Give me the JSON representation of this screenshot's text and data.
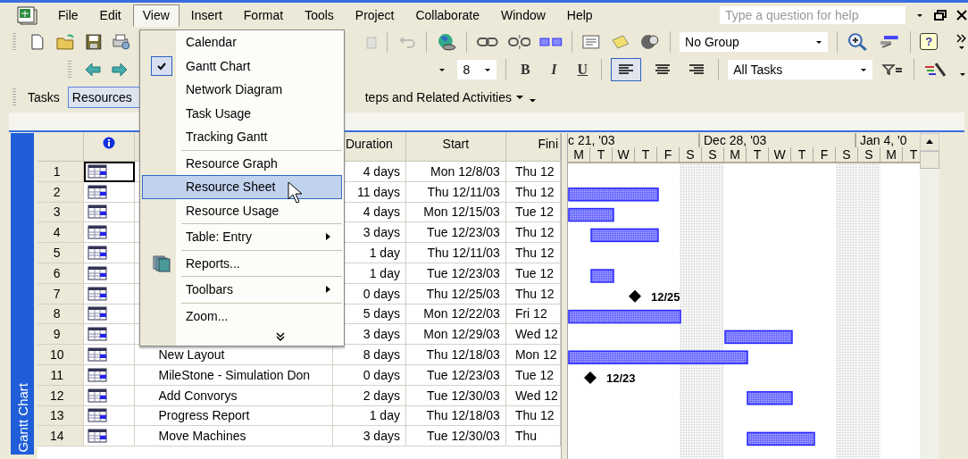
{
  "menubar": [
    {
      "label": "File",
      "selected": false
    },
    {
      "label": "Edit",
      "selected": false
    },
    {
      "label": "View",
      "selected": true
    },
    {
      "label": "Insert",
      "selected": false
    },
    {
      "label": "Format",
      "selected": false
    },
    {
      "label": "Tools",
      "selected": false
    },
    {
      "label": "Project",
      "selected": false
    },
    {
      "label": "Collaborate",
      "selected": false
    },
    {
      "label": "Window",
      "selected": false
    },
    {
      "label": "Help",
      "selected": false
    }
  ],
  "help_search": {
    "placeholder": "Type a question for help"
  },
  "toolbar": {
    "group_select": "No Group",
    "help_button": "?",
    "font_size": "8",
    "format_buttons": [
      "B",
      "I",
      "U"
    ],
    "filter_select": "All Tasks"
  },
  "guide_bar": {
    "tabs": [
      {
        "label": "Tasks",
        "selected": false
      },
      {
        "label": "Resources",
        "selected": true
      }
    ],
    "dropdown": "teps and Related Activities"
  },
  "view_menu": [
    {
      "label": "Calendar",
      "kind": "plain",
      "checked": false,
      "selected": false
    },
    {
      "label": "Gantt Chart",
      "kind": "plain",
      "checked": true,
      "selected": false
    },
    {
      "label": "Network Diagram",
      "kind": "plain",
      "checked": false,
      "selected": false
    },
    {
      "label": "Task Usage",
      "kind": "plain",
      "checked": false,
      "selected": false
    },
    {
      "label": "Tracking Gantt",
      "kind": "plain",
      "checked": false,
      "selected": false
    },
    {
      "kind": "separator"
    },
    {
      "label": "Resource Graph",
      "kind": "plain",
      "checked": false,
      "selected": false
    },
    {
      "label": "Resource Sheet",
      "kind": "plain",
      "checked": false,
      "selected": true
    },
    {
      "label": "Resource Usage",
      "kind": "plain",
      "checked": false,
      "selected": false
    },
    {
      "kind": "separator"
    },
    {
      "label": "Table: Entry",
      "kind": "submenu",
      "checked": false,
      "selected": false
    },
    {
      "kind": "separator"
    },
    {
      "label": "Reports...",
      "kind": "with-icon",
      "checked": false,
      "selected": false
    },
    {
      "kind": "separator"
    },
    {
      "label": "Toolbars",
      "kind": "submenu",
      "checked": false,
      "selected": false
    },
    {
      "kind": "separator"
    },
    {
      "label": "Zoom...",
      "kind": "plain",
      "checked": false,
      "selected": false
    },
    {
      "kind": "more"
    }
  ],
  "side_label": "Gantt Chart",
  "table": {
    "columns": [
      "Duration",
      "Start",
      "Fini"
    ],
    "rows": [
      {
        "id": "1",
        "duration": "4 days",
        "start": "Mon 12/8/03",
        "finish": "Thu 12",
        "selected": true
      },
      {
        "id": "2",
        "duration": "11 days",
        "start": "Thu 12/11/03",
        "finish": "Thu 12",
        "selected": false
      },
      {
        "id": "3",
        "duration": "4 days",
        "start": "Mon 12/15/03",
        "finish": "Tue 12",
        "selected": false
      },
      {
        "id": "4",
        "duration": "3 days",
        "start": "Tue 12/23/03",
        "finish": "Thu 12",
        "selected": false
      },
      {
        "id": "5",
        "duration": "1 day",
        "start": "Thu 12/11/03",
        "finish": "Thu 12",
        "selected": false
      },
      {
        "id": "6",
        "duration": "1 day",
        "start": "Tue 12/23/03",
        "finish": "Tue 12",
        "selected": false
      },
      {
        "id": "7",
        "duration": "0 days",
        "start": "Thu 12/25/03",
        "finish": "Thu 12",
        "selected": false
      },
      {
        "id": "8",
        "duration": "5 days",
        "start": "Mon 12/22/03",
        "finish": "Fri 12",
        "selected": false
      },
      {
        "id": "9",
        "duration": "3 days",
        "start": "Mon 12/29/03",
        "finish": "Wed 12",
        "selected": false
      },
      {
        "id": "10",
        "name": "New Layout",
        "duration": "8 days",
        "start": "Thu 12/18/03",
        "finish": "Mon 12",
        "selected": false
      },
      {
        "id": "11",
        "name": "MileStone - Simulation Don",
        "duration": "0 days",
        "start": "Tue 12/23/03",
        "finish": "Tue 12",
        "selected": false
      },
      {
        "id": "12",
        "name": "Add Convorys",
        "duration": "2 days",
        "start": "Tue 12/30/03",
        "finish": "Wed 12",
        "selected": false
      },
      {
        "id": "13",
        "name": "Progress Report",
        "duration": "1 day",
        "start": "Thu 12/18/03",
        "finish": "Thu 12",
        "selected": false
      },
      {
        "id": "14",
        "name": "Move Machines",
        "duration": "3 days",
        "start": "Tue 12/30/03",
        "finish": "Thu",
        "selected": false
      }
    ]
  },
  "gantt": {
    "weeks": [
      "c 21, '03",
      "Dec 28, '03",
      "Jan 4, '0"
    ],
    "days": [
      {
        "label": "M",
        "nonworking": false
      },
      {
        "label": "T",
        "nonworking": false
      },
      {
        "label": "W",
        "nonworking": false
      },
      {
        "label": "T",
        "nonworking": false
      },
      {
        "label": "F",
        "nonworking": false
      },
      {
        "label": "S",
        "nonworking": true
      },
      {
        "label": "S",
        "nonworking": true
      },
      {
        "label": "M",
        "nonworking": false
      },
      {
        "label": "T",
        "nonworking": false
      },
      {
        "label": "W",
        "nonworking": false
      },
      {
        "label": "T",
        "nonworking": false
      },
      {
        "label": "F",
        "nonworking": false
      },
      {
        "label": "S",
        "nonworking": true
      },
      {
        "label": "S",
        "nonworking": true
      },
      {
        "label": "M",
        "nonworking": false
      },
      {
        "label": "T",
        "nonworking": false
      }
    ],
    "milestone_labels": [
      "12/25",
      "12/23"
    ]
  }
}
